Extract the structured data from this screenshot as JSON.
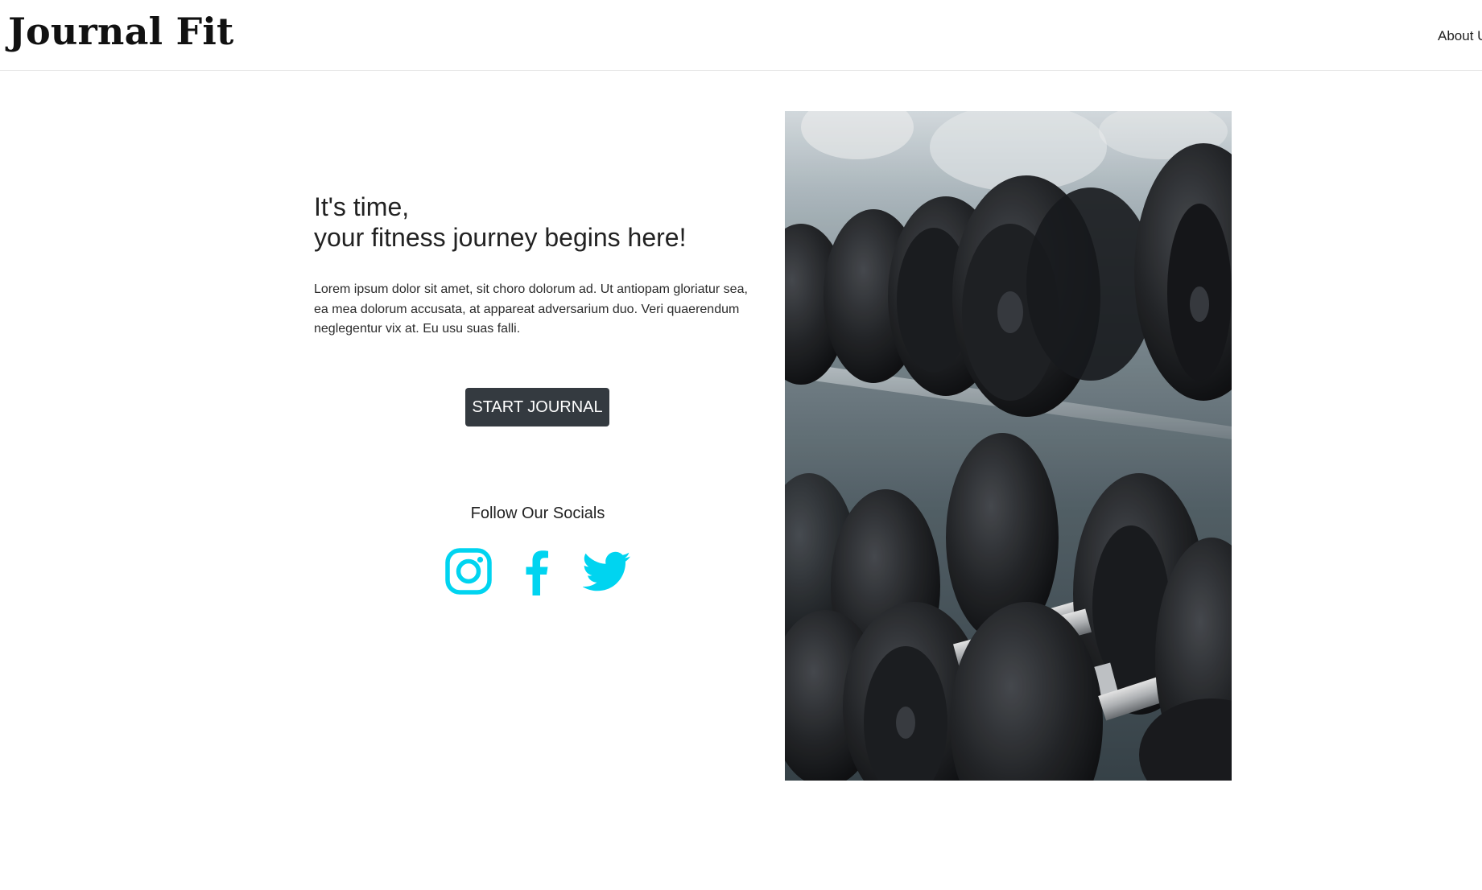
{
  "brand": {
    "name": "Journal Fit"
  },
  "nav": {
    "about_label": "About U"
  },
  "hero": {
    "headline_line1": "It's time,",
    "headline_line2": "your fitness journey begins here!",
    "body": "Lorem ipsum dolor sit amet, sit choro dolorum ad. Ut antiopam gloriatur sea, ea mea dolorum accusata, at appareat adversarium duo. Veri quaerendum neglegentur vix at. Eu usu suas falli.",
    "cta_label": "START JOURNAL"
  },
  "socials": {
    "title": "Follow Our Socials",
    "icons": [
      "instagram-icon",
      "facebook-icon",
      "twitter-icon"
    ],
    "accent_color": "#00d4f0"
  },
  "colors": {
    "button_bg": "#343a40",
    "button_text": "#ffffff",
    "text": "#212529"
  }
}
